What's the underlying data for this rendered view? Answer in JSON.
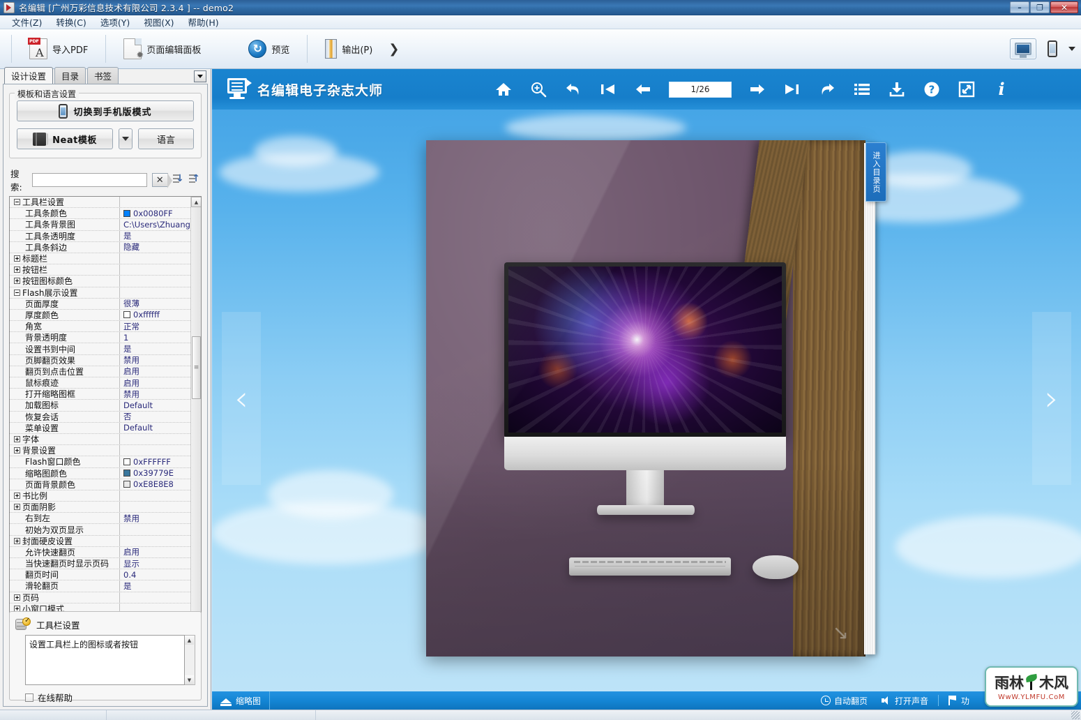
{
  "window": {
    "title": "名编辑 [广州万彩信息技术有限公司 2.3.4 ] -- demo2",
    "minimize": "–",
    "maximize": "❐",
    "close": "✕"
  },
  "menubar": {
    "items": [
      {
        "label": "文件(Z)",
        "name": "menu-file"
      },
      {
        "label": "转换(C)",
        "name": "menu-convert"
      },
      {
        "label": "选项(Y)",
        "name": "menu-options"
      },
      {
        "label": "视图(X)",
        "name": "menu-view"
      },
      {
        "label": "帮助(H)",
        "name": "menu-help"
      }
    ]
  },
  "ribbon": {
    "import_pdf": "导入PDF",
    "page_edit_panel": "页面编辑面板",
    "preview": "预览",
    "output": "输出(P)",
    "more_chevron": "❯",
    "device_desktop_icon": "monitor-icon",
    "device_mobile_icon": "phone-icon"
  },
  "left_panel": {
    "tabs": [
      {
        "label": "设计设置",
        "active": true
      },
      {
        "label": "目录",
        "active": false
      },
      {
        "label": "书签",
        "active": false
      }
    ],
    "template_group_legend": "模板和语言设置",
    "switch_mobile_button": "切换到手机版模式",
    "template_button": "Neat模板",
    "language_button": "语言",
    "search_label": "搜索:",
    "search_value": "",
    "search_placeholder": "",
    "clear_button": "✕",
    "sort_az_icon": "sort-descending-icon",
    "sort_za_icon": "sort-ascending-icon",
    "help": {
      "title": "工具栏设置",
      "description": "设置工具栏上的图标或者按钮",
      "online_help_label": "在线帮助",
      "online_help_checked": false
    },
    "properties": [
      {
        "name": "工具栏设置",
        "value": "",
        "level": 1,
        "expander": "minus"
      },
      {
        "name": "工具条颜色",
        "value": "0x0080FF",
        "level": 2,
        "swatch": "#0080FF"
      },
      {
        "name": "工具条背景图",
        "value": "C:\\Users\\Zhuang\\App...",
        "level": 2
      },
      {
        "name": "工具条透明度",
        "value": "是",
        "level": 2
      },
      {
        "name": "工具条斜边",
        "value": "隐藏",
        "level": 2
      },
      {
        "name": "标题栏",
        "value": "",
        "level": 1,
        "expander": "plus"
      },
      {
        "name": "按钮栏",
        "value": "",
        "level": 1,
        "expander": "plus"
      },
      {
        "name": "按钮图标颜色",
        "value": "",
        "level": 1,
        "expander": "plus"
      },
      {
        "name": "Flash展示设置",
        "value": "",
        "level": 1,
        "expander": "minus"
      },
      {
        "name": "页面厚度",
        "value": "很薄",
        "level": 2
      },
      {
        "name": "厚度颜色",
        "value": "0xffffff",
        "level": 2,
        "swatch": "#ffffff"
      },
      {
        "name": "角宽",
        "value": "正常",
        "level": 2
      },
      {
        "name": "背景透明度",
        "value": "1",
        "level": 2
      },
      {
        "name": "设置书到中间",
        "value": "是",
        "level": 2
      },
      {
        "name": "页脚翻页效果",
        "value": "禁用",
        "level": 2
      },
      {
        "name": "翻页到点击位置",
        "value": "启用",
        "level": 2
      },
      {
        "name": "鼠标痕迹",
        "value": "启用",
        "level": 2
      },
      {
        "name": "打开缩略图框",
        "value": "禁用",
        "level": 2
      },
      {
        "name": "加载图标",
        "value": "Default",
        "level": 2
      },
      {
        "name": "恢复会话",
        "value": "否",
        "level": 2
      },
      {
        "name": "菜单设置",
        "value": "Default",
        "level": 2
      },
      {
        "name": "字体",
        "value": "",
        "level": 1,
        "expander": "plus"
      },
      {
        "name": "背景设置",
        "value": "",
        "level": 1,
        "expander": "plus"
      },
      {
        "name": "Flash窗口颜色",
        "value": "0xFFFFFF",
        "level": 2,
        "swatch": "#FFFFFF"
      },
      {
        "name": "缩略图颜色",
        "value": "0x39779E",
        "level": 2,
        "swatch": "#39779E"
      },
      {
        "name": "页面背景颜色",
        "value": "0xE8E8E8",
        "level": 2,
        "swatch": "#E8E8E8"
      },
      {
        "name": "书比例",
        "value": "",
        "level": 1,
        "expander": "plus"
      },
      {
        "name": "页面阴影",
        "value": "",
        "level": 1,
        "expander": "plus"
      },
      {
        "name": "右到左",
        "value": "禁用",
        "level": 2
      },
      {
        "name": "初始为双页显示",
        "value": "",
        "level": 2
      },
      {
        "name": "封面硬皮设置",
        "value": "",
        "level": 1,
        "expander": "plus"
      },
      {
        "name": "允许快速翻页",
        "value": "启用",
        "level": 2
      },
      {
        "name": "当快速翻页时显示页码",
        "value": "显示",
        "level": 2
      },
      {
        "name": "翻页时间",
        "value": "0.4",
        "level": 2
      },
      {
        "name": "滑轮翻页",
        "value": "是",
        "level": 2
      },
      {
        "name": "页码",
        "value": "",
        "level": 1,
        "expander": "plus"
      },
      {
        "name": "小窗口模式",
        "value": "",
        "level": 1,
        "expander": "plus"
      }
    ]
  },
  "preview": {
    "brand": "名编辑电子杂志大师",
    "page_indicator": "1/26",
    "toolbar_icons": [
      "home-icon",
      "zoom-in-icon",
      "undo-icon",
      "first-page-icon",
      "prev-page-icon",
      "next-page-icon",
      "last-page-icon",
      "redo-icon",
      "table-of-contents-icon",
      "download-icon",
      "help-icon",
      "fullscreen-icon",
      "info-icon"
    ],
    "side_tab": "进入目录页",
    "nav_prev": "‹",
    "nav_next": "›",
    "status": {
      "thumbnail": "缩略图",
      "auto_flip": "自动翻页",
      "open_sound": "打开声音",
      "flag_label": "功"
    },
    "watermark": {
      "text1": "雨林",
      "text2": "木风",
      "url": "WwW.YLMFU.CoM"
    }
  }
}
